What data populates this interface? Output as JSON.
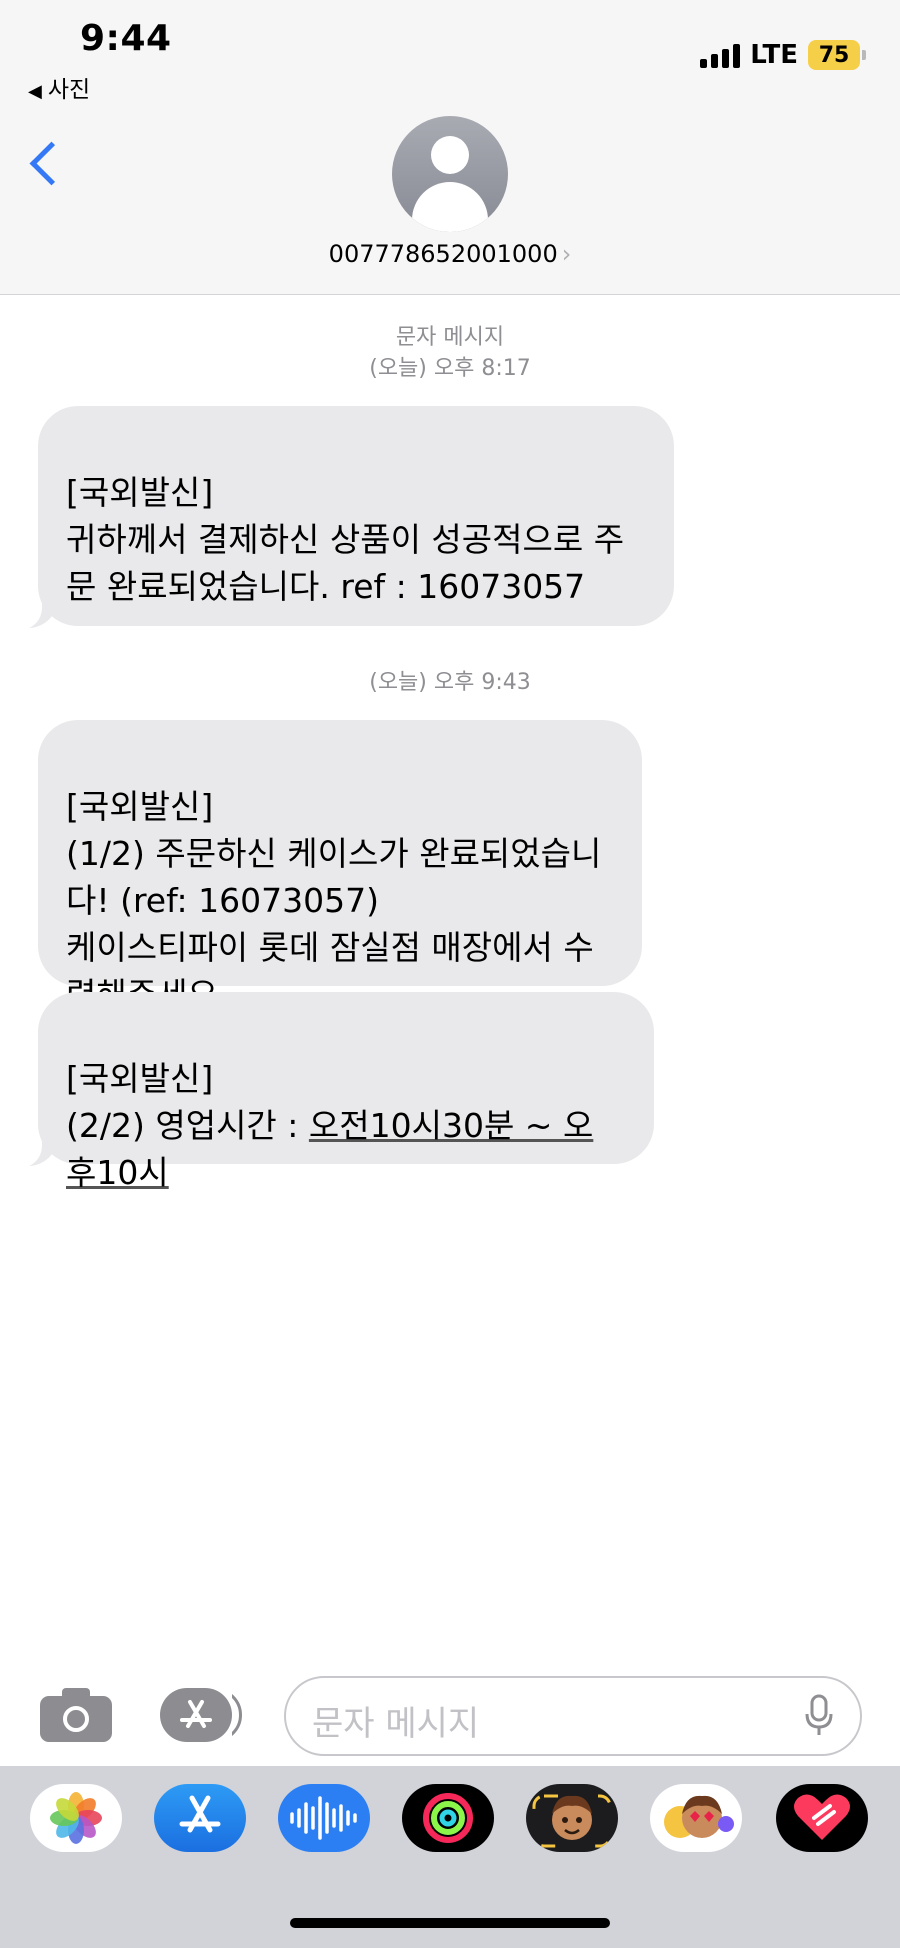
{
  "status_bar": {
    "time": "9:44",
    "back_app": "사진",
    "network": "LTE",
    "battery": "75"
  },
  "header": {
    "contact_number": "007778652001000",
    "contact_chevron": "›"
  },
  "messages": [
    {
      "type": "timestamp",
      "lines": [
        "문자 메시지",
        "(오늘) 오후 8:17"
      ]
    },
    {
      "type": "bubble",
      "text": "[국외발신]\n귀하께서 결제하신 상품이 성공적으로 주문 완료되었습니다.  ref : 16073057"
    },
    {
      "type": "timestamp",
      "lines": [
        "(오늘) 오후 9:43"
      ]
    },
    {
      "type": "bubble",
      "text": "[국외발신]\n(1/2) 주문하신 케이스가 완료되었습니다! (ref: 16073057)\n케이스티파이 롯데 잠실점 매장에서 수령해주세요."
    },
    {
      "type": "bubble",
      "prefix": "[국외발신]\n(2/2) 영업시간 : ",
      "link_line1": "오전10시30분 ~ 오",
      "link_line2": "후10시"
    }
  ],
  "input_bar": {
    "placeholder": "문자 메시지",
    "camera_icon": "camera-icon",
    "apps_icon": "app-store-icon",
    "mic_icon": "microphone-icon"
  },
  "app_drawer": [
    {
      "name": "photos-app-icon"
    },
    {
      "name": "app-store-app-icon"
    },
    {
      "name": "audio-message-app-icon"
    },
    {
      "name": "activity-app-icon"
    },
    {
      "name": "memoji-app-icon"
    },
    {
      "name": "memoji-stickers-app-icon"
    },
    {
      "name": "digital-touch-app-icon"
    }
  ],
  "colors": {
    "accent": "#3478f6",
    "bubble": "#e9e9eb",
    "header_bg": "#f6f6f6",
    "drawer_bg": "#d1d3d9",
    "battery": "#f6cf48"
  }
}
